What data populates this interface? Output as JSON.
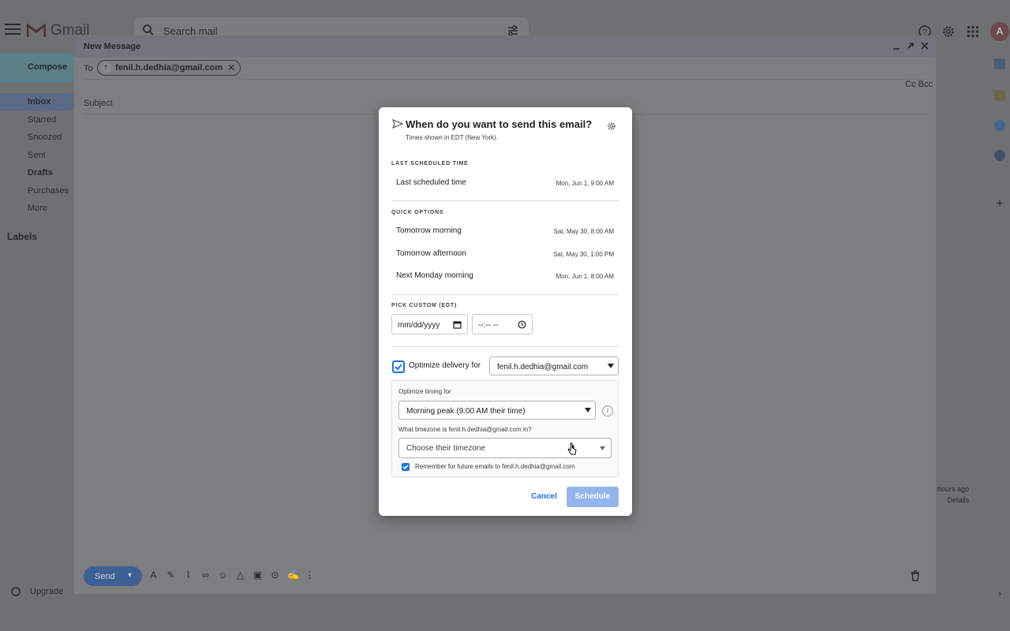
{
  "app": {
    "logo_text": "Gmail",
    "avatar_initial": "A"
  },
  "search": {
    "placeholder": "Search mail"
  },
  "sidebar": {
    "compose_label": "Compose",
    "items": [
      {
        "label": "Inbox"
      },
      {
        "label": "Starred"
      },
      {
        "label": "Snoozed"
      },
      {
        "label": "Sent"
      },
      {
        "label": "Drafts"
      },
      {
        "label": "Purchases"
      },
      {
        "label": "More"
      }
    ],
    "labels_heading": "Labels",
    "upgrade_label": "Upgrade"
  },
  "mail_footer": {
    "time": "hours ago",
    "details": "Details"
  },
  "compose": {
    "title": "New Message",
    "to_label": "To",
    "recipient": "fenil.h.dedhia@gmail.com",
    "recipient_initial": "f",
    "cc_bcc": "Cc Bcc",
    "subject_placeholder": "Subject",
    "send_label": "Send"
  },
  "schedule": {
    "title": "When do you want to send this email?",
    "subtitle": "Times shown in EDT (New York).",
    "last_heading": "LAST SCHEDULED TIME",
    "last_option": {
      "label": "Last scheduled time",
      "time": "Mon, Jun 1, 9:00 AM"
    },
    "quick_heading": "QUICK OPTIONS",
    "quick_options": [
      {
        "label": "Tomorrow morning",
        "time": "Sat, May 30, 8:00 AM"
      },
      {
        "label": "Tomorrow afternoon",
        "time": "Sat, May 30, 1:00 PM"
      },
      {
        "label": "Next Monday morning",
        "time": "Mon, Jun 1, 8:00 AM"
      }
    ],
    "custom_heading": "PICK CUSTOM (EDT)",
    "date_placeholder": "mm/dd/yyyy",
    "time_placeholder": "--:-- --",
    "optimize_label": "Optimize delivery for",
    "optimize_checked": true,
    "optimize_recipient": "fenil.h.dedhia@gmail.com",
    "timing_label": "Optimize timing for",
    "timing_value": "Morning peak (9:00 AM their time)",
    "timezone_question": "What timezone is fenil.h.dedhia@gmail.com in?",
    "timezone_placeholder": "Choose their timezone",
    "remember_label": "Remember for future emails to fenil.h.dedhia@gmail.com",
    "remember_checked": true,
    "cancel_label": "Cancel",
    "schedule_label": "Schedule"
  },
  "colors": {
    "accent": "#1a73e8",
    "schedule_disabled": "#93b5ec",
    "send_button": "#3e5f94"
  }
}
